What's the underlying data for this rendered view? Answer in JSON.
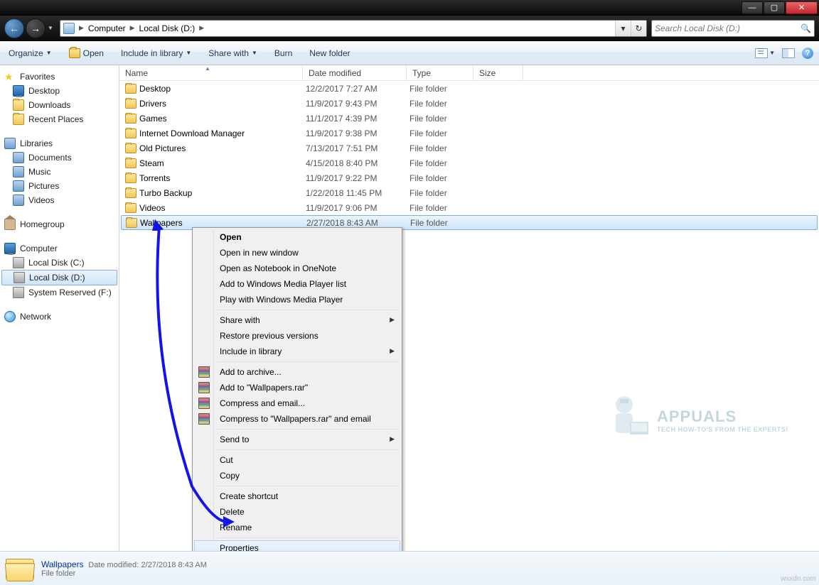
{
  "titlebar": {
    "min": "—",
    "max": "▢",
    "close": "✕"
  },
  "nav": {
    "back": "←",
    "forward": "→",
    "history_drop": "▼",
    "refresh": "↻",
    "addr_drop": "▾"
  },
  "breadcrumb": {
    "root": "Computer",
    "drive": "Local Disk (D:)"
  },
  "search": {
    "placeholder": "Search Local Disk (D:)"
  },
  "toolbar": {
    "organize": "Organize",
    "open": "Open",
    "include": "Include in library",
    "share": "Share with",
    "burn": "Burn",
    "newfolder": "New folder",
    "help": "?"
  },
  "sidebar": {
    "favorites": "Favorites",
    "fav": [
      "Desktop",
      "Downloads",
      "Recent Places"
    ],
    "libraries": "Libraries",
    "lib": [
      "Documents",
      "Music",
      "Pictures",
      "Videos"
    ],
    "homegroup": "Homegroup",
    "computer": "Computer",
    "drives": [
      "Local Disk (C:)",
      "Local Disk (D:)",
      "System Reserved (F:)"
    ],
    "network": "Network"
  },
  "columns": {
    "name": "Name",
    "date": "Date modified",
    "type": "Type",
    "size": "Size"
  },
  "files": [
    {
      "name": "Desktop",
      "date": "12/2/2017 7:27 AM",
      "type": "File folder"
    },
    {
      "name": "Drivers",
      "date": "11/9/2017 9:43 PM",
      "type": "File folder"
    },
    {
      "name": "Games",
      "date": "11/1/2017 4:39 PM",
      "type": "File folder"
    },
    {
      "name": "Internet Download Manager",
      "date": "11/9/2017 9:38 PM",
      "type": "File folder"
    },
    {
      "name": "Old Pictures",
      "date": "7/13/2017 7:51 PM",
      "type": "File folder"
    },
    {
      "name": "Steam",
      "date": "4/15/2018 8:40 PM",
      "type": "File folder"
    },
    {
      "name": "Torrents",
      "date": "11/9/2017 9:22 PM",
      "type": "File folder"
    },
    {
      "name": "Turbo Backup",
      "date": "1/22/2018 11:45 PM",
      "type": "File folder"
    },
    {
      "name": "Videos",
      "date": "11/9/2017 9:06 PM",
      "type": "File folder"
    },
    {
      "name": "Wallpapers",
      "date": "2/27/2018 8:43 AM",
      "type": "File folder"
    }
  ],
  "ctx": {
    "open": "Open",
    "openwin": "Open in new window",
    "onenote": "Open as Notebook in OneNote",
    "addwmp": "Add to Windows Media Player list",
    "playwmp": "Play with Windows Media Player",
    "share": "Share with",
    "restore": "Restore previous versions",
    "include": "Include in library",
    "archive": "Add to archive...",
    "addrar": "Add to \"Wallpapers.rar\"",
    "compemail": "Compress and email...",
    "comprar": "Compress to \"Wallpapers.rar\" and email",
    "sendto": "Send to",
    "cut": "Cut",
    "copy": "Copy",
    "shortcut": "Create shortcut",
    "delete": "Delete",
    "rename": "Rename",
    "properties": "Properties"
  },
  "details": {
    "name": "Wallpapers",
    "type": "File folder",
    "datelabel": "Date modified:",
    "datevalue": "2/27/2018 8:43 AM"
  },
  "watermark": {
    "brand": "APPUALS",
    "tag": "TECH HOW-TO'S FROM THE EXPERTS!",
    "corner": "wsxdn.com"
  }
}
